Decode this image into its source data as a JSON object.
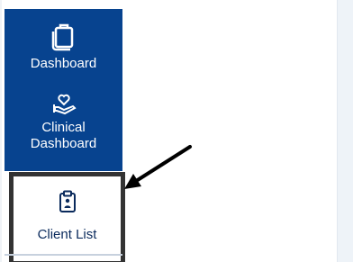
{
  "sidebar": {
    "items": [
      {
        "label": "Dashboard",
        "icon": "briefcase-stack-icon"
      },
      {
        "label": "Clinical\nDashboard",
        "icon": "hand-heart-icon"
      },
      {
        "label": "Client List",
        "icon": "clipboard-user-icon"
      }
    ]
  },
  "annotation": {
    "icon": "arrow-pointer-icon",
    "color": "#000000"
  },
  "colors": {
    "sidebar_bg": "#07438f",
    "sidebar_text": "#ffffff",
    "active_text": "#0a2a5c",
    "highlight_border": "#333333"
  }
}
